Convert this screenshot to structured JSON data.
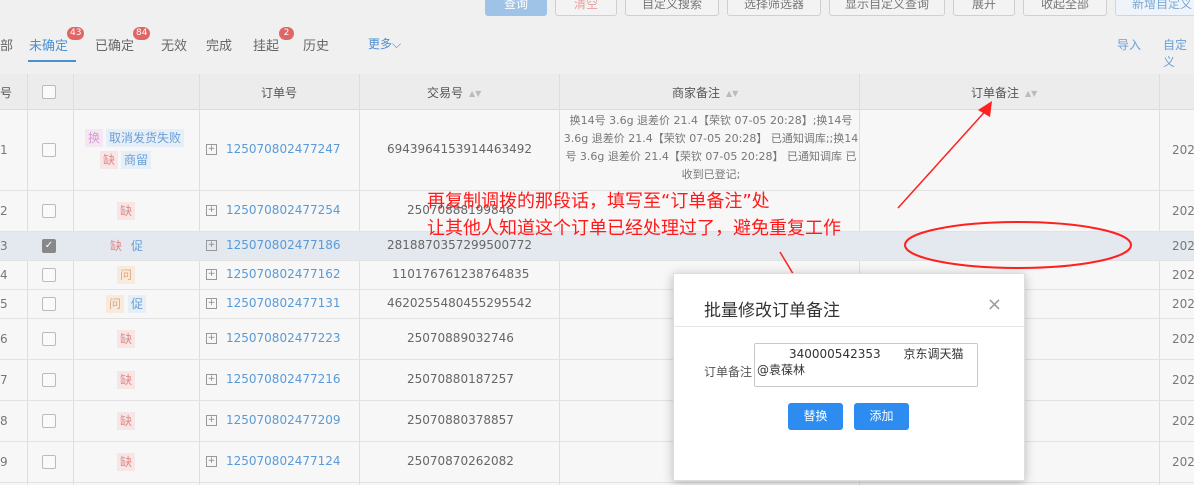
{
  "toolbar": {
    "buttons": [
      "查询",
      "清空",
      "自定义搜索",
      "选择筛选器",
      "显示自定义查询",
      "展开",
      "收起全部",
      "新增自定义"
    ]
  },
  "tabs": [
    {
      "label": "部"
    },
    {
      "label": "未确定",
      "badge": "43"
    },
    {
      "label": "已确定",
      "badge": "84"
    },
    {
      "label": "无效"
    },
    {
      "label": "完成"
    },
    {
      "label": "挂起",
      "badge": "2"
    },
    {
      "label": "历史"
    },
    {
      "label": "更多"
    }
  ],
  "links": {
    "import": "导入",
    "custom": "自定义"
  },
  "table": {
    "headers": {
      "no": "号",
      "order": "订单号",
      "trade": "交易号",
      "merchant_note": "商家备注",
      "order_note": "订单备注"
    },
    "rows": [
      {
        "idx": "1",
        "checked": false,
        "tags": [
          "换",
          "取消发货失败",
          "缺",
          "商留"
        ],
        "order": "125070802477247",
        "trade": "6943964153914463492",
        "note": "换14号 3.6g 退差价 21.4【荣钦 07-05 20:28】;换14号 3.6g 退差价 21.4【荣钦 07-05 20:28】 已通知调库;;换14号 3.6g 退差价 21.4【荣钦 07-05 20:28】 已通知调库 已收到已登记;",
        "date": "202"
      },
      {
        "idx": "2",
        "checked": false,
        "tags": [
          "缺"
        ],
        "order": "125070802477254",
        "trade": "25070888199846",
        "date": "202"
      },
      {
        "idx": "3",
        "checked": true,
        "tags": [
          "缺",
          "促"
        ],
        "order": "125070802477186",
        "trade": "2818870357299500772",
        "date": "202"
      },
      {
        "idx": "4",
        "checked": false,
        "tags": [
          "问"
        ],
        "order": "125070802477162",
        "trade": "110176761238764835",
        "date": "202"
      },
      {
        "idx": "5",
        "checked": false,
        "tags": [
          "问",
          "促"
        ],
        "order": "125070802477131",
        "trade": "4620255480455295542",
        "date": "202"
      },
      {
        "idx": "6",
        "checked": false,
        "tags": [
          "缺"
        ],
        "order": "125070802477223",
        "trade": "25070889032746",
        "date": "202"
      },
      {
        "idx": "7",
        "checked": false,
        "tags": [
          "缺"
        ],
        "order": "125070802477216",
        "trade": "25070880187257",
        "date": "202"
      },
      {
        "idx": "8",
        "checked": false,
        "tags": [
          "缺"
        ],
        "order": "125070802477209",
        "trade": "25070880378857",
        "date": "202"
      },
      {
        "idx": "9",
        "checked": false,
        "tags": [
          "缺"
        ],
        "order": "125070802477124",
        "trade": "25070870262082",
        "date": "202"
      }
    ]
  },
  "annotation": {
    "line1": "再复制调拨的那段话，填写至“订单备注”处",
    "line2": "让其他人知道这个订单已经处理过了，避免重复工作"
  },
  "dialog": {
    "title": "批量修改订单备注",
    "close": "×",
    "label": "订单备注",
    "text_line1": "340000542353      京东调天猫",
    "text_line2": "@袁葆林",
    "replace": "替换",
    "add": "添加"
  }
}
